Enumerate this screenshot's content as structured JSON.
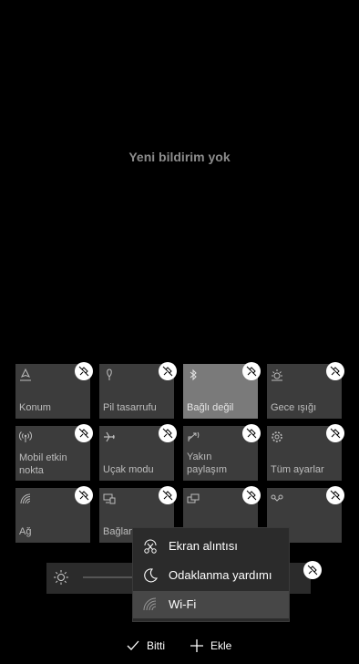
{
  "notifications": {
    "empty_text": "Yeni bildirim yok"
  },
  "tiles": [
    {
      "label": "Konum",
      "icon": "location-icon",
      "style": "dark"
    },
    {
      "label": "Pil tasarrufu",
      "icon": "battery-saver-icon",
      "style": "dark"
    },
    {
      "label": "Bağlı değil",
      "icon": "bluetooth-icon",
      "style": "light"
    },
    {
      "label": "Gece ışığı",
      "icon": "night-light-icon",
      "style": "dark"
    },
    {
      "label": "Mobil etkin nokta",
      "icon": "hotspot-icon",
      "style": "dark"
    },
    {
      "label": "Uçak modu",
      "icon": "airplane-icon",
      "style": "dark"
    },
    {
      "label": "Yakın paylaşım",
      "icon": "nearby-share-icon",
      "style": "dark"
    },
    {
      "label": "Tüm ayarlar",
      "icon": "gear-icon",
      "style": "dark"
    },
    {
      "label": "Ağ",
      "icon": "network-icon",
      "style": "dark"
    },
    {
      "label": "Bağlan",
      "icon": "connect-icon",
      "style": "dark"
    },
    {
      "label": "",
      "icon": "project-icon",
      "style": "dark"
    },
    {
      "label": "",
      "icon": "vpn-icon",
      "style": "dark"
    }
  ],
  "add_menu": {
    "items": [
      {
        "label": "Ekran alıntısı",
        "icon": "screen-snip-icon"
      },
      {
        "label": "Odaklanma yardımı",
        "icon": "focus-assist-icon"
      },
      {
        "label": "Wi-Fi",
        "icon": "wifi-icon"
      }
    ],
    "selected_index": 2
  },
  "brightness": {
    "icon": "brightness-icon"
  },
  "footer": {
    "done_label": "Bitti",
    "add_label": "Ekle"
  },
  "colors": {
    "tile_dark": "#3c3c3c",
    "tile_light": "#7a7a7a",
    "menu_bg": "#2b2b2b",
    "menu_selected": "#474747"
  }
}
